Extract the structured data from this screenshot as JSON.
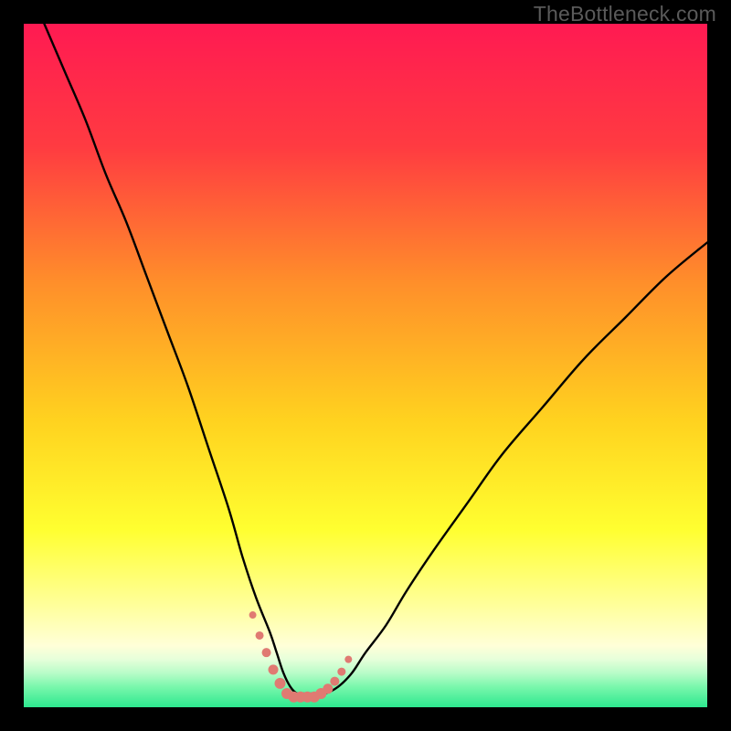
{
  "watermark": "TheBottleneck.com",
  "chart_data": {
    "type": "line",
    "title": "",
    "xlabel": "",
    "ylabel": "",
    "xlim": [
      0,
      100
    ],
    "ylim": [
      0,
      100
    ],
    "grid": false,
    "legend": false,
    "gradient_stops": [
      {
        "offset": 0,
        "color": "#ff1a52"
      },
      {
        "offset": 18,
        "color": "#ff3b41"
      },
      {
        "offset": 38,
        "color": "#ff8f2a"
      },
      {
        "offset": 58,
        "color": "#ffd21f"
      },
      {
        "offset": 74,
        "color": "#ffff30"
      },
      {
        "offset": 85,
        "color": "#ffff9a"
      },
      {
        "offset": 91,
        "color": "#ffffd8"
      },
      {
        "offset": 93,
        "color": "#e6ffda"
      },
      {
        "offset": 95,
        "color": "#b8fcc8"
      },
      {
        "offset": 97,
        "color": "#7af7ac"
      },
      {
        "offset": 100,
        "color": "#2de88f"
      }
    ],
    "series": [
      {
        "name": "bottleneck-curve",
        "x": [
          3,
          6,
          9,
          12,
          15,
          18,
          21,
          24,
          27,
          30,
          32,
          34,
          36,
          37,
          38,
          39,
          40,
          41,
          42,
          44,
          46,
          48,
          50,
          53,
          56,
          60,
          65,
          70,
          76,
          82,
          88,
          94,
          100
        ],
        "y": [
          100,
          93,
          86,
          78,
          71,
          63,
          55,
          47,
          38,
          29,
          22,
          16,
          11,
          8,
          5,
          3,
          2,
          2,
          2,
          2,
          3,
          5,
          8,
          12,
          17,
          23,
          30,
          37,
          44,
          51,
          57,
          63,
          68
        ]
      }
    ],
    "valley_markers": {
      "x": [
        33.5,
        34.5,
        35.5,
        36.5,
        37.5,
        38.5,
        39.5,
        40.5,
        41.5,
        42.5,
        43.5,
        44.5,
        45.5,
        46.5,
        47.5
      ],
      "y": [
        13.5,
        10.5,
        8.0,
        5.5,
        3.5,
        2.0,
        1.5,
        1.5,
        1.5,
        1.5,
        2.0,
        2.7,
        3.8,
        5.2,
        7.0
      ],
      "r": [
        4,
        4.5,
        5,
        5.5,
        6,
        6,
        6,
        6,
        6,
        6,
        6,
        5.5,
        5,
        4.5,
        4
      ]
    }
  }
}
